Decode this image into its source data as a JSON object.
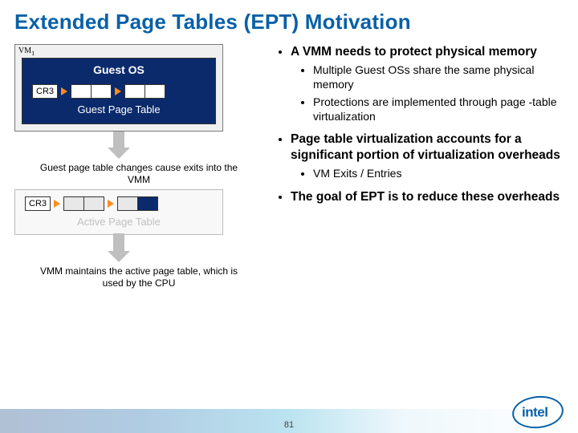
{
  "title": "Extended Page Tables (EPT) Motivation",
  "page_number": "81",
  "logo_text": "intel",
  "diagram": {
    "vm_label": "VM",
    "vm_sub": "1",
    "guest_os": "Guest OS",
    "cr3": "CR3",
    "guest_pt_label": "Guest Page Table",
    "caption1": "Guest page table changes cause exits into the VMM",
    "active_pt_label": "Active Page Table",
    "caption2": "VMM maintains the active page table, which is used by the CPU"
  },
  "bullets": {
    "b1": "A VMM needs to protect physical memory",
    "b1a": "Multiple Guest OSs share the same physical memory",
    "b1b": "Protections are implemented through page -table virtualization",
    "b2": "Page table virtualization accounts for a significant portion of virtualization overheads",
    "b2a": "VM Exits / Entries",
    "b3": "The goal of EPT is to reduce these overheads"
  }
}
